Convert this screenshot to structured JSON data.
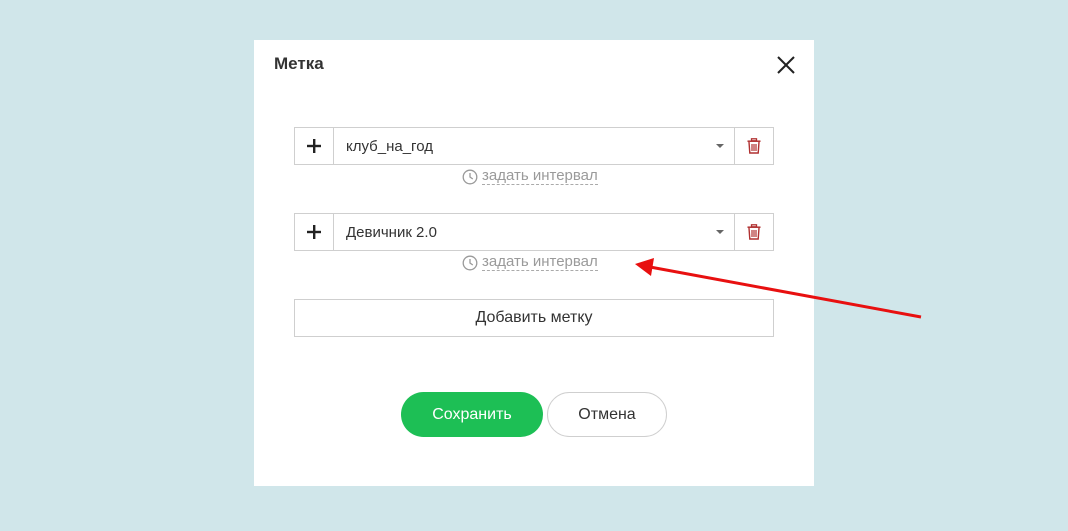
{
  "dialog": {
    "title": "Метка",
    "close_icon": "close-icon"
  },
  "tags": [
    {
      "value": "клуб_на_год",
      "interval_label": "задать интервал"
    },
    {
      "value": "Девичник 2.0",
      "interval_label": "задать интервал"
    }
  ],
  "buttons": {
    "add_tag": "Добавить метку",
    "save": "Сохранить",
    "cancel": "Отмена"
  },
  "icons": {
    "plus": "plus-icon",
    "delete": "trash-icon",
    "clock": "clock-icon",
    "dropdown": "chevron-down-icon"
  },
  "colors": {
    "background": "#d0e6ea",
    "accent_green": "#1dbf55",
    "delete_red": "#b03030",
    "annotation_arrow": "#e81010"
  }
}
